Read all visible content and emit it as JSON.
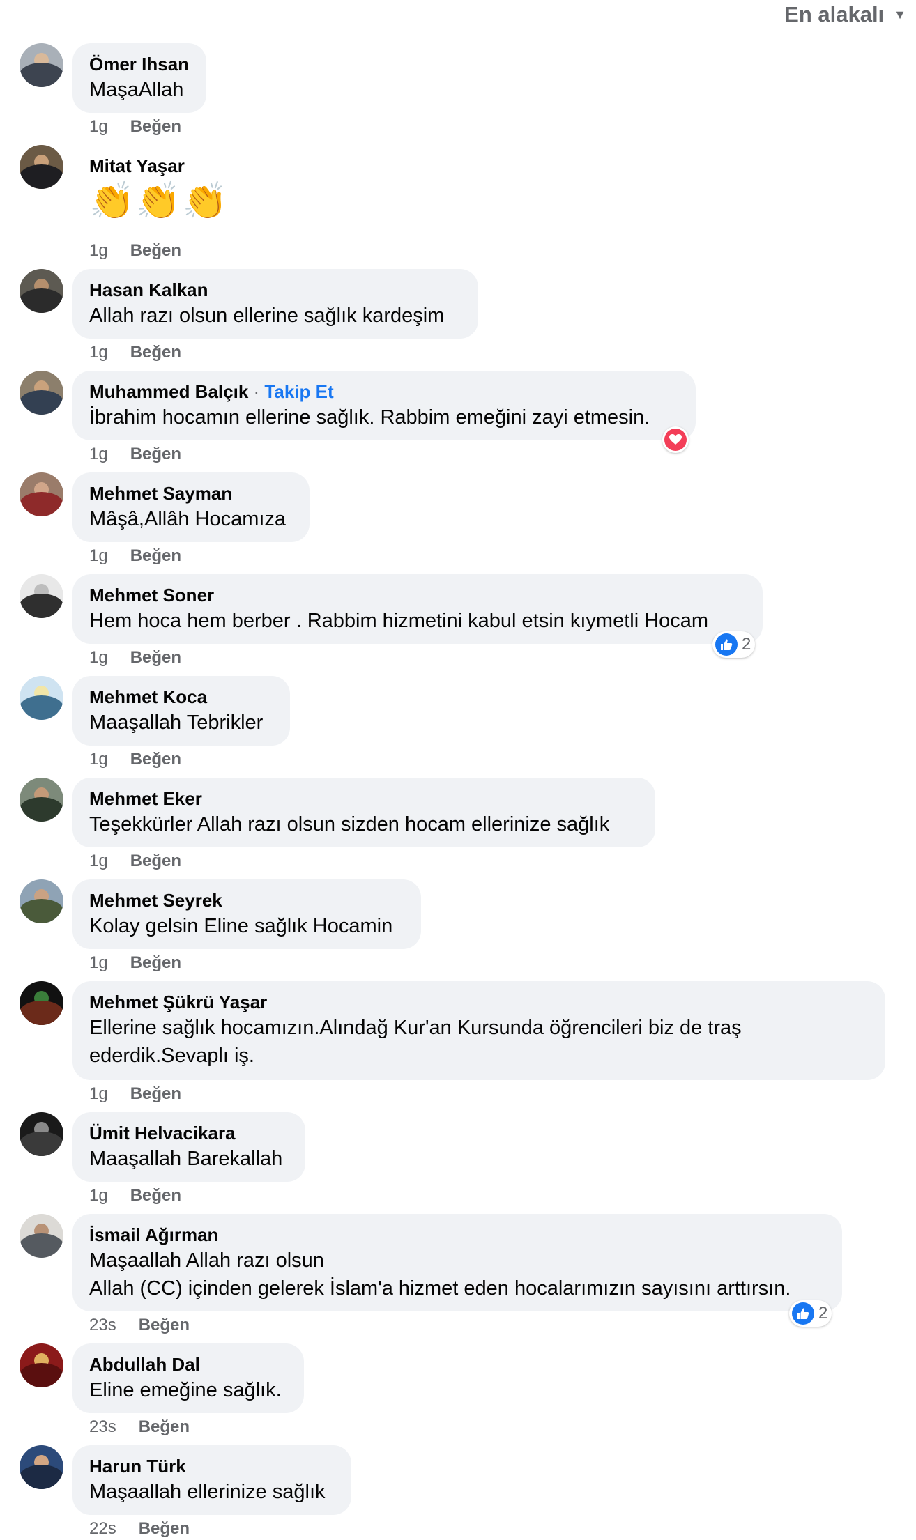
{
  "sort": {
    "label": "En alakalı"
  },
  "comments": [
    {
      "author": "Ömer Ihsan",
      "text": "MaşaAllah",
      "time": "1g",
      "like_label": "Beğen"
    },
    {
      "author": "Mitat Yaşar",
      "text": "👏👏👏",
      "time": "1g",
      "like_label": "Beğen"
    },
    {
      "author": "Hasan Kalkan",
      "text": "Allah razı olsun ellerine sağlık kardeşim",
      "time": "1g",
      "like_label": "Beğen"
    },
    {
      "author": "Muhammed Balçık",
      "follow": "Takip Et",
      "text": "İbrahim hocamın ellerine sağlık. Rabbim emeğini zayi etmesin.",
      "time": "1g",
      "like_label": "Beğen",
      "reaction": {
        "type": "love"
      }
    },
    {
      "author": "Mehmet Sayman",
      "text": "Mâşâ,Allâh Hocamıza",
      "time": "1g",
      "like_label": "Beğen"
    },
    {
      "author": "Mehmet Soner",
      "text": "Hem hoca hem berber . Rabbim hizmetini kabul etsin kıymetli Hocam",
      "time": "1g",
      "like_label": "Beğen",
      "reaction": {
        "type": "like",
        "count": "2"
      }
    },
    {
      "author": "Mehmet Koca",
      "text": "Maaşallah Tebrikler",
      "time": "1g",
      "like_label": "Beğen"
    },
    {
      "author": "Mehmet Eker",
      "text": "Teşekkürler Allah razı olsun sizden hocam ellerinize sağlık",
      "time": "1g",
      "like_label": "Beğen"
    },
    {
      "author": "Mehmet Seyrek",
      "text": "Kolay gelsin Eline sağlık Hocamin",
      "time": "1g",
      "like_label": "Beğen"
    },
    {
      "author": "Mehmet Şükrü Yaşar",
      "text": "Ellerine sağlık hocamızın.Alındağ Kur'an Kursunda öğrencileri biz de traş\nederdik.Sevaplı iş.",
      "time": "1g",
      "like_label": "Beğen"
    },
    {
      "author": "Ümit Helvacikara",
      "text": "Maaşallah Barekallah",
      "time": "1g",
      "like_label": "Beğen"
    },
    {
      "author": "İsmail Ağırman",
      "text": "Maşaallah Allah razı olsun\nAllah (CC) içinden gelerek İslam'a hizmet eden hocalarımızın sayısını arttırsın.",
      "time": "23s",
      "like_label": "Beğen",
      "reaction": {
        "type": "like",
        "count": "2"
      }
    },
    {
      "author": "Abdullah Dal",
      "text": "Eline emeğine sağlık.",
      "time": "23s",
      "like_label": "Beğen"
    },
    {
      "author": "Harun Türk",
      "text": "Maşaallah ellerinize sağlık",
      "time": "22s",
      "like_label": "Beğen"
    }
  ],
  "colors": {
    "bubble": "#f0f2f5",
    "secondary_text": "#65676b",
    "link": "#1877f2",
    "like_blue": "#1877f2",
    "love_red": "#f33e58"
  }
}
